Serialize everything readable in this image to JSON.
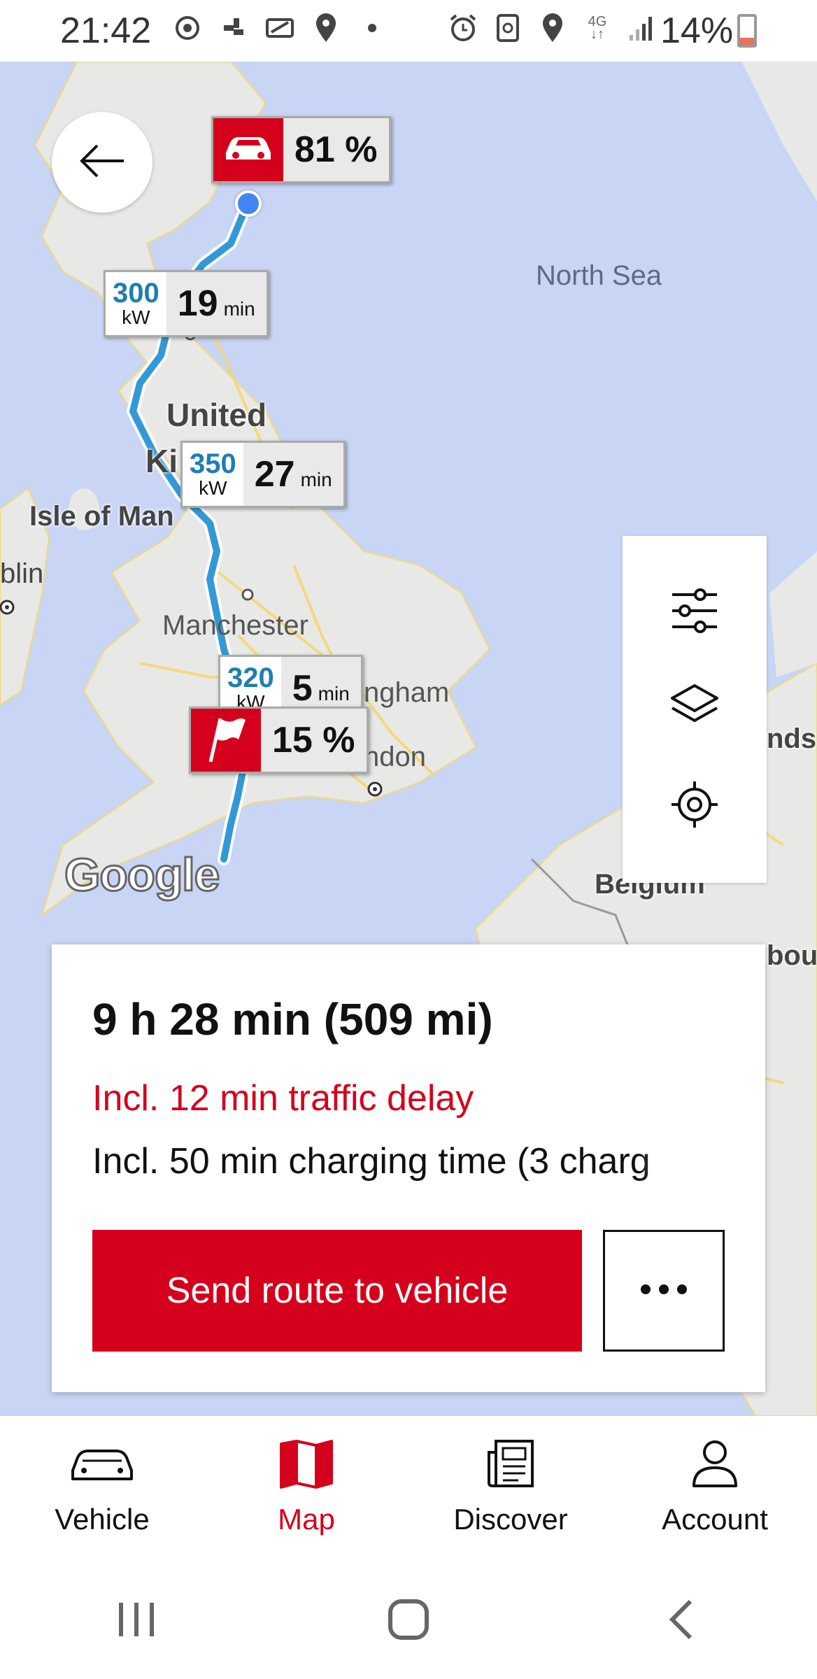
{
  "status_bar": {
    "time": "21:42",
    "battery_percent": "14%",
    "network": "4G",
    "icons": [
      "sync-icon",
      "slack-icon",
      "vpn-icon",
      "location-icon",
      "dot-icon",
      "alarm-icon",
      "nfc-icon",
      "location-icon",
      "signal-icon",
      "battery-icon"
    ]
  },
  "map": {
    "labels": {
      "north_sea": "North Sea",
      "united": "United",
      "kingdom_partial": "Ki",
      "isle_of_man": "Isle of Man",
      "dublin_partial": "blin",
      "manchester": "Manchester",
      "birmingham_partial": "ngham",
      "london_partial": "ndon",
      "netherlands_partial": "nds",
      "belgium": "Belgium",
      "luxembourg_partial": "bou"
    },
    "google_logo": "Google",
    "start_pin": {
      "value": "81 %",
      "icon": "car-icon"
    },
    "charge_stops": [
      {
        "kw": "300",
        "unit": "kW",
        "duration": "19",
        "duration_unit": "min"
      },
      {
        "kw": "350",
        "unit": "kW",
        "duration": "27",
        "duration_unit": "min"
      },
      {
        "kw": "320",
        "unit": "kW",
        "duration": "5",
        "duration_unit": "min"
      }
    ],
    "destination_pin": {
      "value": "15 %",
      "icon": "flag-icon"
    },
    "tools": [
      "filter-sliders-icon",
      "layers-icon",
      "locate-icon"
    ]
  },
  "route_card": {
    "title": "9 h 28 min (509 mi)",
    "traffic_delay": "Incl. 12 min traffic delay",
    "charging_time": "Incl. 50 min charging time (3 charg",
    "send_button": "Send route to vehicle",
    "more_button_icon": "more-dots-icon"
  },
  "bottom_nav": {
    "items": [
      {
        "label": "Vehicle",
        "icon": "car-icon",
        "active": false
      },
      {
        "label": "Map",
        "icon": "map-icon",
        "active": true
      },
      {
        "label": "Discover",
        "icon": "newspaper-icon",
        "active": false
      },
      {
        "label": "Account",
        "icon": "person-icon",
        "active": false
      }
    ]
  },
  "colors": {
    "brand_red": "#d5001c",
    "kw_blue": "#1d7fb0",
    "sea": "#c8d5f4",
    "land": "#e8e8e6",
    "route": "#3399d6"
  }
}
